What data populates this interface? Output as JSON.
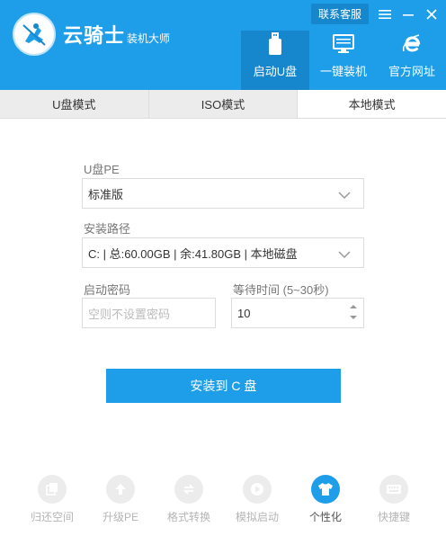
{
  "brand": {
    "name": "云骑士",
    "subtitle": "装机大师"
  },
  "window": {
    "contact_label": "联系客服",
    "menu_icon": "menu-icon",
    "minimize_icon": "minimize-icon",
    "close_icon": "close-icon"
  },
  "nav": {
    "tabs": [
      {
        "label": "启动U盘",
        "icon": "usb-drive-icon",
        "active": true
      },
      {
        "label": "一键装机",
        "icon": "monitor-icon",
        "active": false
      },
      {
        "label": "官方网址",
        "icon": "browser-e-icon",
        "active": false
      }
    ]
  },
  "mode_tabs": [
    {
      "label": "U盘模式",
      "active": false
    },
    {
      "label": "ISO模式",
      "active": false
    },
    {
      "label": "本地模式",
      "active": true
    }
  ],
  "form": {
    "pe_label": "U盘PE",
    "pe_value": "标准版",
    "path_label": "安装路径",
    "path_value": "C: | 总:60.00GB | 余:41.80GB | 本地磁盘",
    "password_label": "启动密码",
    "password_placeholder": "空则不设置密码",
    "wait_label": "等待时间 (5~30秒)",
    "wait_value": "10"
  },
  "install_button": "安装到 C 盘",
  "tools": [
    {
      "label": "归还空间",
      "icon": "restore-space-icon",
      "active": false
    },
    {
      "label": "升级PE",
      "icon": "upgrade-arrow-icon",
      "active": false
    },
    {
      "label": "格式转换",
      "icon": "convert-icon",
      "active": false
    },
    {
      "label": "模拟启动",
      "icon": "play-icon",
      "active": false
    },
    {
      "label": "个性化",
      "icon": "tshirt-icon",
      "active": true
    },
    {
      "label": "快捷键",
      "icon": "keyboard-icon",
      "active": false
    }
  ],
  "colors": {
    "accent": "#1e9ee8",
    "accent_dark": "#1687cc",
    "muted": "#b5b5b5"
  }
}
